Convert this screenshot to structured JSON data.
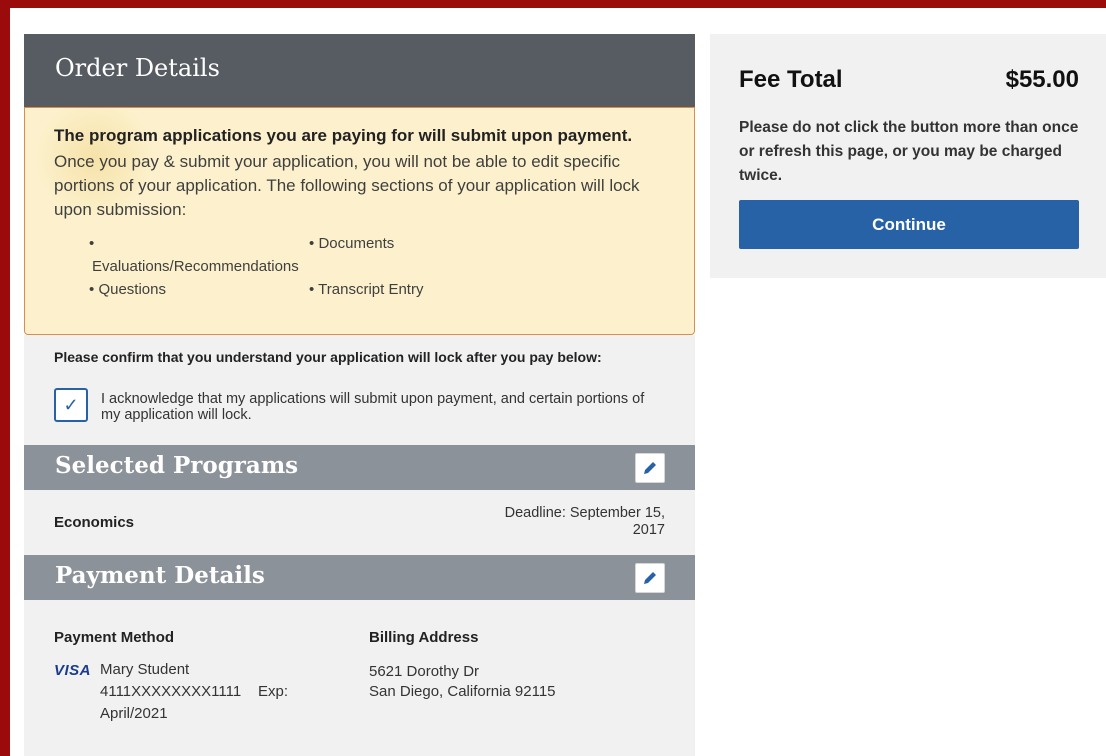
{
  "order_details": {
    "title": "Order Details",
    "notice_title": "The program applications you are paying for will submit upon payment.",
    "notice_body": "Once you pay & submit your application, you will not be able to edit specific portions of your application. The following sections of your application will lock upon submission:",
    "lock_items": [
      "Evaluations/Recommendations",
      "Documents",
      "Questions",
      "Transcript Entry"
    ],
    "bullet": "•"
  },
  "confirm": {
    "question": "Please confirm that you understand your application will lock after you pay below:",
    "acknowledgement": "I acknowledge that my applications will submit upon payment, and certain portions of my application will lock.",
    "checked": true,
    "check_glyph": "✓"
  },
  "selected_programs": {
    "title": "Selected Programs",
    "program": "Economics",
    "deadline_line1": "Deadline: September 15,",
    "deadline_line2": "2017"
  },
  "payment_details": {
    "title": "Payment Details",
    "method_label": "Payment Method",
    "billing_label": "Billing Address",
    "card_brand": "VISA",
    "card_name": "Mary Student",
    "card_number": "4111XXXXXXXX1111",
    "exp_label": "Exp:",
    "exp_date": "April/2021",
    "address_line1": "5621 Dorothy Dr",
    "address_line2": "San Diego, California 92115"
  },
  "fee": {
    "label": "Fee Total",
    "amount": "$55.00",
    "warning": "Please do not click the button more than once or refresh this page, or you may be charged twice.",
    "continue_label": "Continue"
  },
  "icons": {
    "edit": "pencil-icon",
    "check": "checkmark-icon"
  },
  "colors": {
    "frame": "#9c0b0b",
    "header_dark": "#575c63",
    "header_light": "#8c929a",
    "notice_bg": "#fcf1cc",
    "notice_border": "#d88d4a",
    "primary": "#2762a7"
  }
}
